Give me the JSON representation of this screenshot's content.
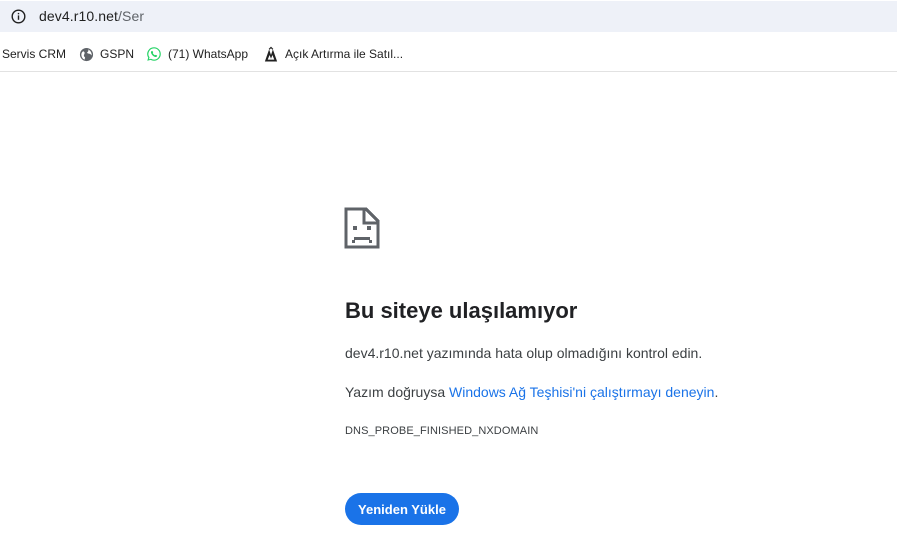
{
  "address_bar": {
    "host": "dev4.r10.net",
    "path": "/Ser",
    "info_icon": "info-icon"
  },
  "bookmarks": [
    {
      "label": "Servis CRM",
      "icon": "none"
    },
    {
      "label": "GSPN",
      "icon": "globe-icon"
    },
    {
      "label": "(71) WhatsApp",
      "icon": "whatsapp-icon"
    },
    {
      "label": "Açık Artırma ile Satıl...",
      "icon": "auction-icon"
    }
  ],
  "error_page": {
    "icon": "sad-document-icon",
    "title": "Bu siteye ulaşılamıyor",
    "line1": "dev4.r10.net yazımında hata olup olmadığını kontrol edin.",
    "line2_prefix": "Yazım doğruysa ",
    "line2_link": "Windows Ağ Teşhisi'ni çalıştırmayı deneyin",
    "line2_suffix": ".",
    "error_code": "DNS_PROBE_FINISHED_NXDOMAIN",
    "reload_label": "Yeniden Yükle"
  },
  "colors": {
    "accent": "#1a73e8",
    "omnibox_bg": "#eef1f8",
    "text": "#202124"
  }
}
